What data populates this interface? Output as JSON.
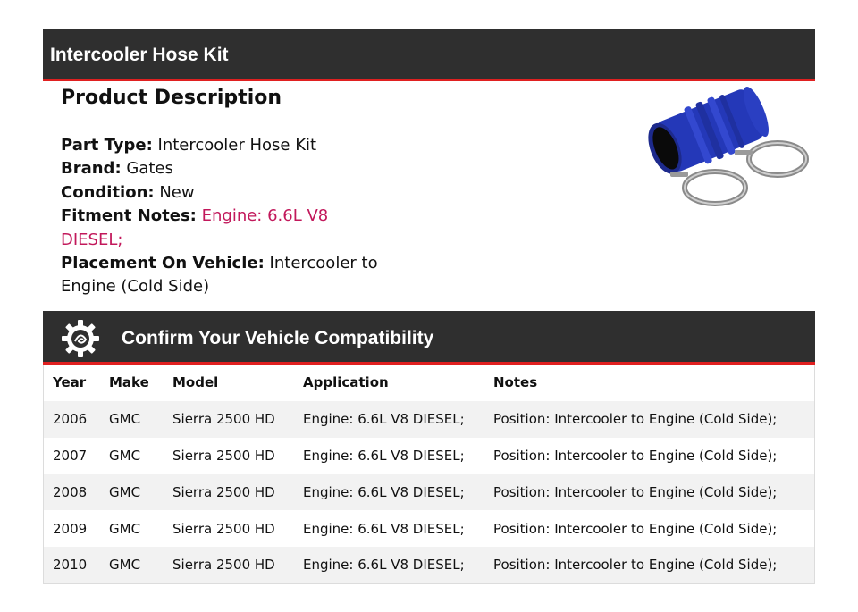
{
  "product_panel": {
    "header_title": "Intercooler Hose Kit",
    "description_title": "Product Description",
    "specs": [
      {
        "label": "Part Type:",
        "value": "Intercooler Hose Kit"
      },
      {
        "label": "Brand:",
        "value": "Gates"
      },
      {
        "label": "Condition:",
        "value": "New"
      },
      {
        "label": "Fitment Notes:",
        "value": "Engine: 6.6L V8 DIESEL;"
      },
      {
        "label": "Placement On Vehicle:",
        "value": "Intercooler to Engine (Cold Side)"
      }
    ],
    "image_icon": "hose-kit-image",
    "fitment_color": "#c2185b"
  },
  "compatibility": {
    "header_title": "Confirm Your Vehicle Compatibility",
    "header_icon": "gear-icon",
    "columns": [
      "Year",
      "Make",
      "Model",
      "Application",
      "Notes"
    ],
    "rows": [
      [
        "2006",
        "GMC",
        "Sierra 2500 HD",
        "Engine: 6.6L V8 DIESEL;",
        "Position: Intercooler to Engine (Cold Side);"
      ],
      [
        "2007",
        "GMC",
        "Sierra 2500 HD",
        "Engine: 6.6L V8 DIESEL;",
        "Position: Intercooler to Engine (Cold Side);"
      ],
      [
        "2008",
        "GMC",
        "Sierra 2500 HD",
        "Engine: 6.6L V8 DIESEL;",
        "Position: Intercooler to Engine (Cold Side);"
      ],
      [
        "2009",
        "GMC",
        "Sierra 2500 HD",
        "Engine: 6.6L V8 DIESEL;",
        "Position: Intercooler to Engine (Cold Side);"
      ],
      [
        "2010",
        "GMC",
        "Sierra 2500 HD",
        "Engine: 6.6L V8 DIESEL;",
        "Position: Intercooler to Engine (Cold Side);"
      ]
    ]
  },
  "colors": {
    "header_bg": "#2f2f2f",
    "accent_red": "#e02020",
    "hose_blue": "#2438b8"
  }
}
